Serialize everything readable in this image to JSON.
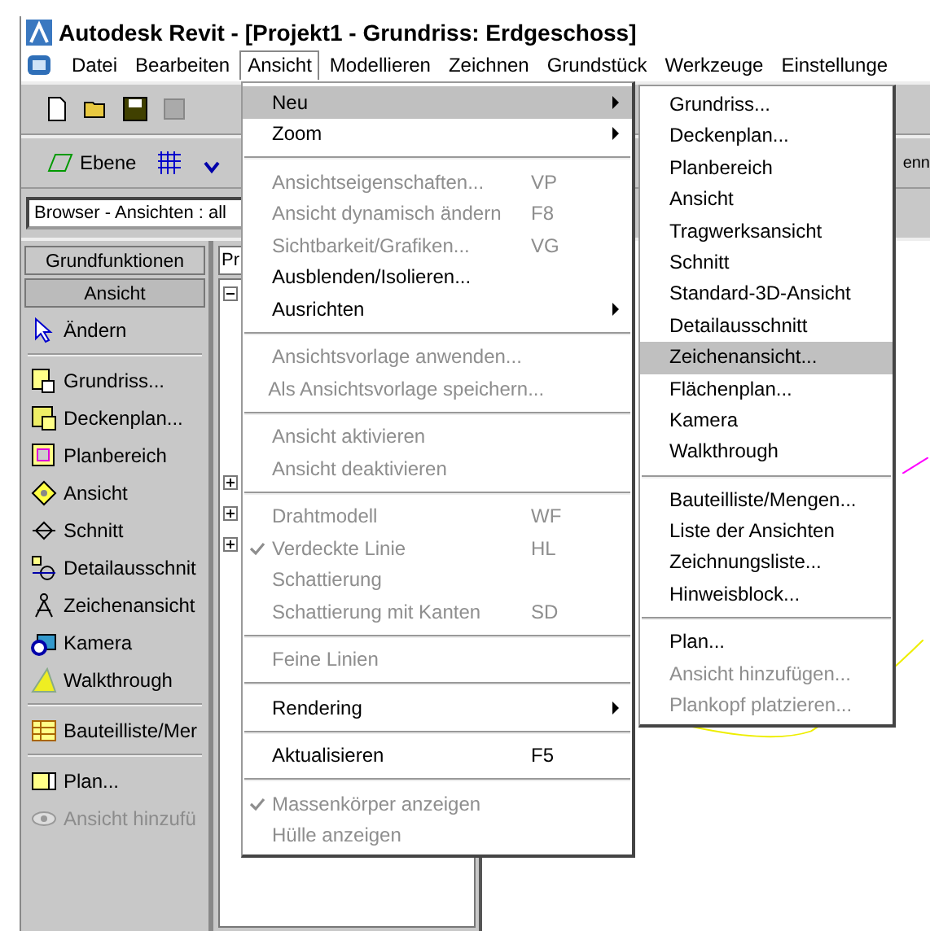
{
  "window": {
    "title": "Autodesk Revit - [Projekt1 - Grundriss: Erdgeschoss]"
  },
  "menubar": [
    {
      "label": "Datei",
      "selected": false
    },
    {
      "label": "Bearbeiten",
      "selected": false
    },
    {
      "label": "Ansicht",
      "selected": true
    },
    {
      "label": "Modellieren",
      "selected": false
    },
    {
      "label": "Zeichnen",
      "selected": false
    },
    {
      "label": "Grundstück",
      "selected": false
    },
    {
      "label": "Werkzeuge",
      "selected": false
    },
    {
      "label": "Einstellunge",
      "selected": false
    }
  ],
  "toolbar2": {
    "level_button": "Ebene",
    "cut_text": "enn"
  },
  "browser_combo": {
    "value": "Browser - Ansichten : all"
  },
  "design_bar": {
    "tabs": [
      {
        "label": "Grundfunktionen",
        "selected": false
      },
      {
        "label": "Ansicht",
        "selected": true
      }
    ],
    "groups": [
      [
        {
          "kind": "cursor",
          "label": "Ändern",
          "disabled": false
        }
      ],
      [
        {
          "kind": "plan",
          "label": "Grundriss...",
          "disabled": false
        },
        {
          "kind": "ceiling",
          "label": "Deckenplan...",
          "disabled": false
        },
        {
          "kind": "region",
          "label": "Planbereich",
          "disabled": false
        },
        {
          "kind": "elevation",
          "label": "Ansicht",
          "disabled": false
        },
        {
          "kind": "section",
          "label": "Schnitt",
          "disabled": false
        },
        {
          "kind": "detail",
          "label": "Detailausschnit",
          "disabled": false
        },
        {
          "kind": "drafting",
          "label": "Zeichenansicht",
          "disabled": false
        },
        {
          "kind": "camera",
          "label": "Kamera",
          "disabled": false
        },
        {
          "kind": "walkthrough",
          "label": "Walkthrough",
          "disabled": false
        }
      ],
      [
        {
          "kind": "schedule",
          "label": "Bauteilliste/Mer",
          "disabled": false
        }
      ],
      [
        {
          "kind": "sheet",
          "label": "Plan...",
          "disabled": false
        },
        {
          "kind": "eye",
          "label": "Ansicht hinzufü",
          "disabled": true
        }
      ]
    ]
  },
  "project_browser": {
    "header": "Pr"
  },
  "view_menu": [
    {
      "kind": "item",
      "label": "Neu",
      "submenu": true,
      "disabled": false,
      "checked": false,
      "selected": true
    },
    {
      "kind": "item",
      "label": "Zoom",
      "submenu": true,
      "disabled": false,
      "checked": false,
      "selected": false
    },
    {
      "kind": "separator"
    },
    {
      "kind": "item",
      "label": "Ansichtseigenschaften...",
      "shortcut": "VP",
      "submenu": false,
      "disabled": true,
      "checked": false,
      "selected": false
    },
    {
      "kind": "item",
      "label": "Ansicht dynamisch ändern",
      "shortcut": "F8",
      "submenu": false,
      "disabled": true,
      "checked": false,
      "selected": false
    },
    {
      "kind": "item",
      "label": "Sichtbarkeit/Grafiken...",
      "shortcut": "VG",
      "submenu": false,
      "disabled": true,
      "checked": false,
      "selected": false
    },
    {
      "kind": "item",
      "label": "Ausblenden/Isolieren...",
      "submenu": false,
      "disabled": false,
      "checked": false,
      "selected": false
    },
    {
      "kind": "item",
      "label": "Ausrichten",
      "submenu": true,
      "disabled": false,
      "checked": false,
      "selected": false
    },
    {
      "kind": "separator"
    },
    {
      "kind": "item",
      "label": "Ansichtsvorlage anwenden...",
      "submenu": false,
      "disabled": true,
      "checked": false,
      "selected": false
    },
    {
      "kind": "item",
      "label": "Als Ansichtsvorlage speichern...",
      "submenu": false,
      "disabled": true,
      "checked": false,
      "selected": false
    },
    {
      "kind": "separator"
    },
    {
      "kind": "item",
      "label": "Ansicht aktivieren",
      "submenu": false,
      "disabled": true,
      "checked": false,
      "selected": false
    },
    {
      "kind": "item",
      "label": "Ansicht deaktivieren",
      "submenu": false,
      "disabled": true,
      "checked": false,
      "selected": false
    },
    {
      "kind": "separator"
    },
    {
      "kind": "item",
      "label": "Drahtmodell",
      "shortcut": "WF",
      "submenu": false,
      "disabled": true,
      "checked": false,
      "selected": false
    },
    {
      "kind": "item",
      "label": "Verdeckte Linie",
      "shortcut": "HL",
      "submenu": false,
      "disabled": true,
      "checked": true,
      "selected": false
    },
    {
      "kind": "item",
      "label": "Schattierung",
      "submenu": false,
      "disabled": true,
      "checked": false,
      "selected": false
    },
    {
      "kind": "item",
      "label": "Schattierung mit Kanten",
      "shortcut": "SD",
      "submenu": false,
      "disabled": true,
      "checked": false,
      "selected": false
    },
    {
      "kind": "separator"
    },
    {
      "kind": "item",
      "label": "Feine Linien",
      "submenu": false,
      "disabled": true,
      "checked": false,
      "selected": false
    },
    {
      "kind": "separator"
    },
    {
      "kind": "item",
      "label": "Rendering",
      "submenu": true,
      "disabled": false,
      "checked": false,
      "selected": false
    },
    {
      "kind": "separator"
    },
    {
      "kind": "item",
      "label": "Aktualisieren",
      "shortcut": "F5",
      "submenu": false,
      "disabled": false,
      "checked": false,
      "selected": false
    },
    {
      "kind": "separator"
    },
    {
      "kind": "item",
      "label": "Massenkörper anzeigen",
      "submenu": false,
      "disabled": true,
      "checked": true,
      "selected": false
    },
    {
      "kind": "item",
      "label": "Hülle anzeigen",
      "submenu": false,
      "disabled": true,
      "checked": false,
      "selected": false
    }
  ],
  "new_submenu": [
    {
      "kind": "item",
      "label": "Grundriss...",
      "disabled": false,
      "selected": false
    },
    {
      "kind": "item",
      "label": "Deckenplan...",
      "disabled": false,
      "selected": false
    },
    {
      "kind": "item",
      "label": "Planbereich",
      "disabled": false,
      "selected": false
    },
    {
      "kind": "item",
      "label": "Ansicht",
      "disabled": false,
      "selected": false
    },
    {
      "kind": "item",
      "label": "Tragwerksansicht",
      "disabled": false,
      "selected": false
    },
    {
      "kind": "item",
      "label": "Schnitt",
      "disabled": false,
      "selected": false
    },
    {
      "kind": "item",
      "label": "Standard-3D-Ansicht",
      "disabled": false,
      "selected": false
    },
    {
      "kind": "item",
      "label": "Detailausschnitt",
      "disabled": false,
      "selected": false
    },
    {
      "kind": "item",
      "label": "Zeichenansicht...",
      "disabled": false,
      "selected": true
    },
    {
      "kind": "item",
      "label": "Flächenplan...",
      "disabled": false,
      "selected": false
    },
    {
      "kind": "item",
      "label": "Kamera",
      "disabled": false,
      "selected": false
    },
    {
      "kind": "item",
      "label": "Walkthrough",
      "disabled": false,
      "selected": false
    },
    {
      "kind": "separator"
    },
    {
      "kind": "item",
      "label": "Bauteilliste/Mengen...",
      "disabled": false,
      "selected": false
    },
    {
      "kind": "item",
      "label": "Liste der Ansichten",
      "disabled": false,
      "selected": false
    },
    {
      "kind": "item",
      "label": "Zeichnungsliste...",
      "disabled": false,
      "selected": false
    },
    {
      "kind": "item",
      "label": "Hinweisblock...",
      "disabled": false,
      "selected": false
    },
    {
      "kind": "separator"
    },
    {
      "kind": "item",
      "label": "Plan...",
      "disabled": false,
      "selected": false
    },
    {
      "kind": "item",
      "label": "Ansicht hinzufügen...",
      "disabled": true,
      "selected": false
    },
    {
      "kind": "item",
      "label": "Plankopf platzieren...",
      "disabled": true,
      "selected": false
    }
  ]
}
